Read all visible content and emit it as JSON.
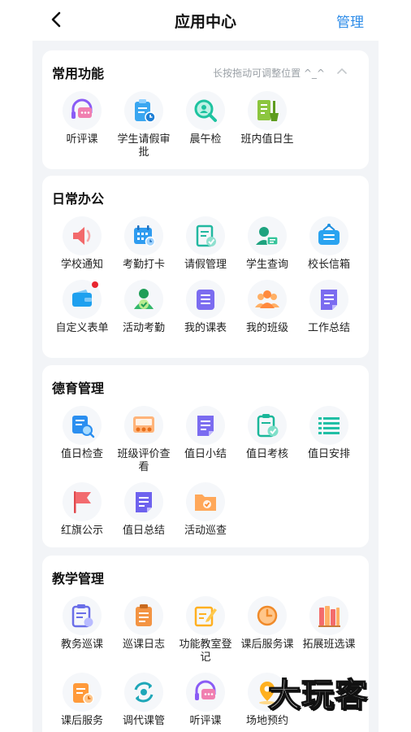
{
  "header": {
    "title": "应用中心",
    "manage_label": "管理"
  },
  "common": {
    "title": "常用功能",
    "hint": "长按拖动可调整位置 ^_^",
    "items": [
      {
        "label": "听评课",
        "icon": "headset-chat-icon"
      },
      {
        "label": "学生请假审批",
        "icon": "leave-approval-icon"
      },
      {
        "label": "晨午检",
        "icon": "magnifier-icon"
      },
      {
        "label": "班内值日生",
        "icon": "broom-icon"
      }
    ]
  },
  "office": {
    "title": "日常办公",
    "items": [
      {
        "label": "学校通知",
        "icon": "speaker-icon"
      },
      {
        "label": "考勤打卡",
        "icon": "calendar-clock-icon"
      },
      {
        "label": "请假管理",
        "icon": "document-check-icon"
      },
      {
        "label": "学生查询",
        "icon": "student-card-icon"
      },
      {
        "label": "校长信箱",
        "icon": "mailbox-icon"
      },
      {
        "label": "自定义表单",
        "icon": "wallet-icon",
        "badge": true
      },
      {
        "label": "活动考勤",
        "icon": "person-check-icon"
      },
      {
        "label": "我的课表",
        "icon": "schedule-icon"
      },
      {
        "label": "我的班级",
        "icon": "class-group-icon"
      },
      {
        "label": "工作总结",
        "icon": "summary-doc-icon"
      }
    ]
  },
  "moral": {
    "title": "德育管理",
    "items": [
      {
        "label": "值日检查",
        "icon": "inspect-list-icon"
      },
      {
        "label": "班级评价查看",
        "icon": "class-rating-icon"
      },
      {
        "label": "值日小结",
        "icon": "short-summary-icon"
      },
      {
        "label": "值日考核",
        "icon": "clipboard-check-icon"
      },
      {
        "label": "值日安排",
        "icon": "arrange-list-icon"
      },
      {
        "label": "红旗公示",
        "icon": "red-flag-icon"
      },
      {
        "label": "值日总结",
        "icon": "duty-summary-icon"
      },
      {
        "label": "活动巡查",
        "icon": "folder-patrol-icon"
      }
    ]
  },
  "teaching": {
    "title": "教学管理",
    "items": [
      {
        "label": "教务巡课",
        "icon": "clipboard-patrol-icon"
      },
      {
        "label": "巡课日志",
        "icon": "log-book-icon"
      },
      {
        "label": "功能教室登记",
        "icon": "pencil-register-icon"
      },
      {
        "label": "课后服务课",
        "icon": "clock-service-icon"
      },
      {
        "label": "拓展班选课",
        "icon": "books-icon"
      },
      {
        "label": "课后服务",
        "icon": "service-clock-icon"
      },
      {
        "label": "调代课管",
        "icon": "swap-lesson-icon"
      },
      {
        "label": "听评课",
        "icon": "headset-chat-icon"
      },
      {
        "label": "场地预约",
        "icon": "location-icon"
      }
    ]
  },
  "watermark": "大玩客"
}
